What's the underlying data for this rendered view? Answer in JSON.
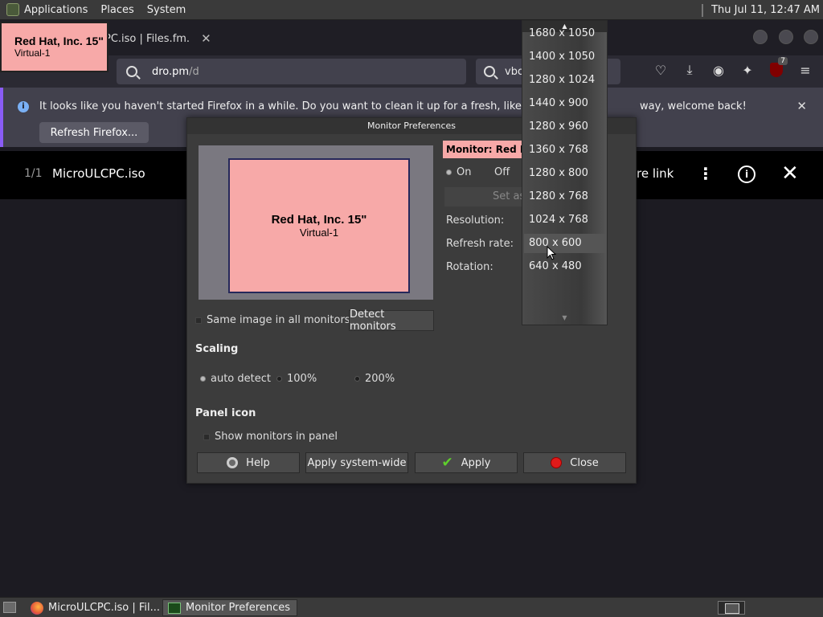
{
  "top_panel": {
    "menus": [
      "Applications",
      "Places",
      "System"
    ],
    "clock": "Thu Jul 11, 12:47 AM"
  },
  "tooltip": {
    "title": "Red Hat, Inc. 15\"",
    "subtitle": "Virtual-1"
  },
  "browser": {
    "tab_title": "PC.iso | Files.fm.",
    "url_host": "dro.pm",
    "url_path": "/d",
    "search_text": "vbox",
    "ublock_badge": "7",
    "notification": {
      "message": "It looks like you haven't started Firefox in a while. Do you want to clean it up for a fresh, like-new experi",
      "message_tail": "way, welcome back!",
      "button": "Refresh Firefox..."
    },
    "viewer": {
      "count": "1/1",
      "filename": "MicroULCPC.iso",
      "share_partial": "re link"
    }
  },
  "dialog": {
    "title": "Monitor Preferences",
    "preview": {
      "name": "Red Hat, Inc. 15\"",
      "output": "Virtual-1"
    },
    "monitor_label": "Monitor: Red H",
    "on_label": "On",
    "off_label": "Off",
    "set_as_label": "Set as",
    "resolution_label": "Resolution:",
    "refresh_label": "Refresh rate:",
    "rotation_label": "Rotation:",
    "same_image_label": "Same image in all monitors",
    "detect_button": "Detect monitors",
    "scaling_heading": "Scaling",
    "scaling_options": [
      "auto detect",
      "100%",
      "200%"
    ],
    "panel_icon_heading": "Panel icon",
    "show_monitors_label": "Show monitors in panel",
    "buttons": {
      "help": "Help",
      "apply_system": "Apply system-wide",
      "apply": "Apply",
      "close": "Close"
    }
  },
  "resolution_dropdown": {
    "items": [
      "1680 x 1050",
      "1400 x 1050",
      "1280 x 1024",
      "1440 x 900",
      "1280 x 960",
      "1360 x 768",
      "1280 x 800",
      "1280 x 768",
      "1024 x 768",
      "800 x 600",
      "640 x 480"
    ],
    "highlighted": "800 x 600"
  },
  "taskbar": {
    "items": [
      "MicroULCPC.iso | Fil...",
      "Monitor Preferences"
    ]
  },
  "colors": {
    "monitor_pink": "#f7a9a8",
    "dialog_bg": "#3c3c3c",
    "notification_accent": "#8a5cf5"
  }
}
